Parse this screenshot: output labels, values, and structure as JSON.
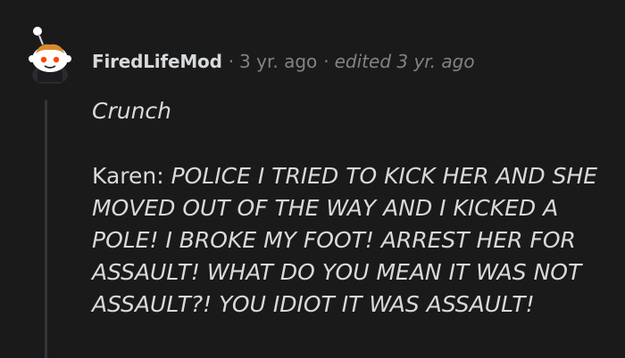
{
  "comment": {
    "author": "FiredLifeMod",
    "separator": "·",
    "age": "3 yr. ago",
    "edited": "edited 3 yr. ago",
    "avatar_icon": "snoo-avatar-icon",
    "paragraph_1": "Crunch",
    "speaker": "Karen:",
    "quote": "POLICE I TRIED TO KICK HER AND SHE MOVED OUT OF THE WAY AND I KICKED A POLE! I BROKE MY FOOT! ARREST HER FOR ASSAULT! WHAT DO YOU MEAN IT WAS NOT ASSAULT?! YOU IDIOT IT WAS ASSAULT!"
  },
  "colors": {
    "background": "#1a1a1b",
    "text": "#d7dadc",
    "meta_text": "#818384",
    "thread_line": "#343536",
    "avatar_accent": "#ff4500"
  }
}
